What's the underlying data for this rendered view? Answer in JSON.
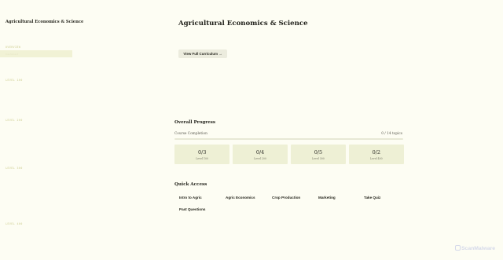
{
  "sidebar": {
    "menu_icon": "",
    "brand": "Agricultural Economics & Science",
    "overview_label": "OVERVIEW",
    "active_item": "Dashboard",
    "levels": [
      "LEVEL 100",
      "LEVEL 200",
      "LEVEL 300",
      "LEVEL 400"
    ]
  },
  "header": {
    "title": "Agricultural Economics & Science ",
    "curriculum_button": "View Full Curriculum →"
  },
  "progress": {
    "section_title": " Overall Progress",
    "label": "Course Completion",
    "count": "0 / 14 topics",
    "fraction": 0,
    "levels": [
      {
        "score": "0/3",
        "label": "Level 100"
      },
      {
        "score": "0/4",
        "label": "Level 200"
      },
      {
        "score": "0/5",
        "label": "Level 300"
      },
      {
        "score": "0/2",
        "label": "Level 400"
      }
    ]
  },
  "quick_access": {
    "section_title": " Quick Access",
    "items": [
      " Intro to Agric",
      " Agric Economics",
      " Crop Production",
      " Marketing",
      " Take Quiz",
      " Past Questions"
    ]
  },
  "watermark": "ScanMalware",
  "colors": {
    "background": "#fdfdf3",
    "card": "#eef0d5",
    "accent": "#f1f2d5"
  }
}
